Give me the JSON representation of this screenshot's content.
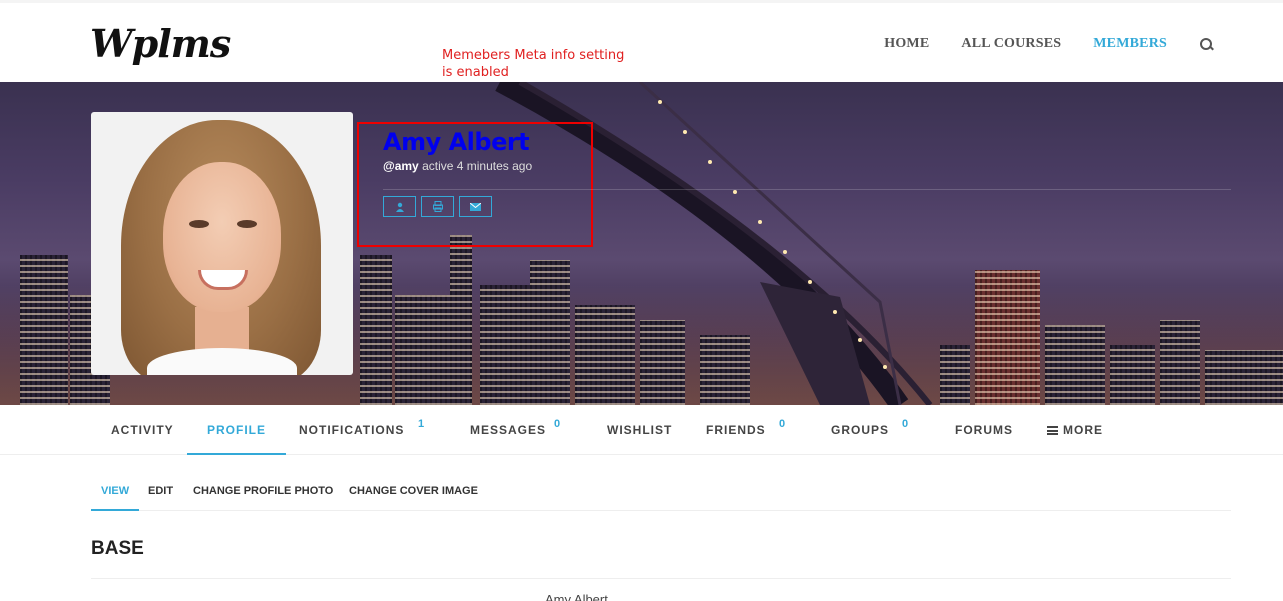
{
  "header": {
    "logo": "Wplms",
    "nav": [
      {
        "label": "HOME",
        "active": false
      },
      {
        "label": "ALL COURSES",
        "active": false
      },
      {
        "label": "MEMBERS",
        "active": true
      }
    ],
    "search_icon": "search-icon"
  },
  "annotation": {
    "line1": "Memebers Meta info setting",
    "line2": "is enabled"
  },
  "profile": {
    "name": "Amy Albert",
    "username": "@amy",
    "activity": "active 4 minutes ago",
    "action_icons": [
      "user-icon",
      "print-icon",
      "message-icon"
    ]
  },
  "tabs": [
    {
      "label": "ACTIVITY",
      "count": ""
    },
    {
      "label": "PROFILE",
      "count": ""
    },
    {
      "label": "NOTIFICATIONS",
      "count": "1"
    },
    {
      "label": "MESSAGES",
      "count": "0"
    },
    {
      "label": "WISHLIST",
      "count": ""
    },
    {
      "label": "FRIENDS",
      "count": "0"
    },
    {
      "label": "GROUPS",
      "count": "0"
    },
    {
      "label": "FORUMS",
      "count": ""
    },
    {
      "label": "MORE",
      "count": ""
    }
  ],
  "subtabs": [
    {
      "label": "VIEW"
    },
    {
      "label": "EDIT"
    },
    {
      "label": "CHANGE PROFILE PHOTO"
    },
    {
      "label": "CHANGE COVER IMAGE"
    }
  ],
  "section": {
    "title": "BASE",
    "first_field_value": "Amy Albert"
  },
  "colors": {
    "accent": "#33a9d8",
    "annotation": "#e02020",
    "name": "#0000ee"
  }
}
